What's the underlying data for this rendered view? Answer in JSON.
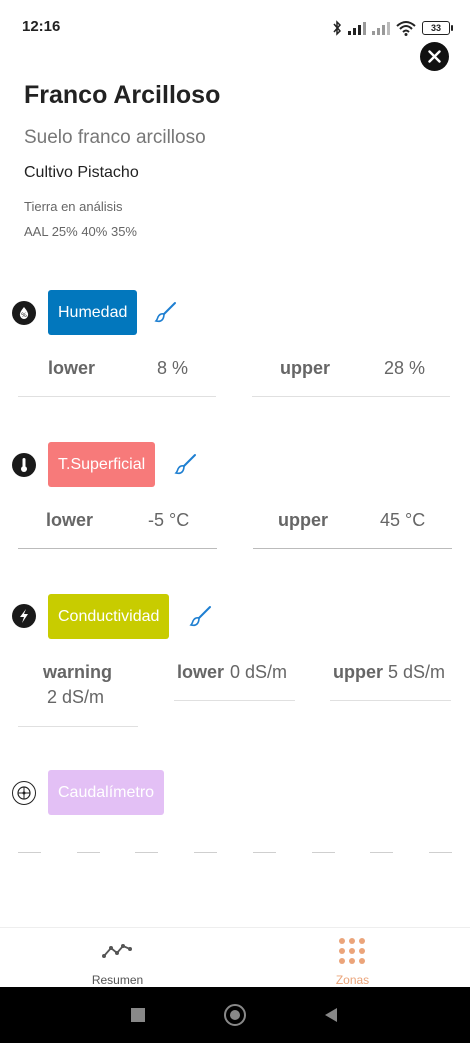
{
  "status": {
    "time": "12:16",
    "battery": "33"
  },
  "header": {
    "title": "Franco Arcilloso",
    "subtitle": "Suelo franco arcilloso",
    "crop": "Cultivo Pistacho",
    "status_text": "Tierra en análisis",
    "composition": "AAL 25% 40% 35%"
  },
  "sensors": {
    "humedad": {
      "label": "Humedad",
      "color": "#0277BD",
      "lower_label": "lower",
      "lower_value": "8 %",
      "upper_label": "upper",
      "upper_value": "28 %"
    },
    "tsuperficial": {
      "label": "T.Superficial",
      "color": "#F77A7A",
      "lower_label": "lower",
      "lower_value": "-5 °C",
      "upper_label": "upper",
      "upper_value": "45 °C"
    },
    "conductividad": {
      "label": "Conductividad",
      "color": "#C8CC00",
      "warning_label": "warning",
      "warning_value": "2 dS/m",
      "lower_label": "lower",
      "lower_value": "0 dS/m",
      "upper_label": "upper",
      "upper_value": "5 dS/m"
    },
    "caudalimetro": {
      "label": "Caudalímetro",
      "color": "#E3C0F5"
    }
  },
  "nav": {
    "resumen": "Resumen",
    "zonas": "Zonas",
    "active_color": "#EBA47A"
  },
  "icons": {
    "close": "close-icon",
    "humidity": "humidity-drop-icon",
    "thermometer": "thermometer-icon",
    "lightning": "lightning-icon",
    "flowmeter": "flowmeter-icon",
    "brush": "brush-icon",
    "chart": "line-chart-icon",
    "grid": "grid-dots-icon"
  }
}
